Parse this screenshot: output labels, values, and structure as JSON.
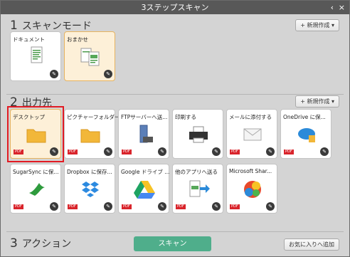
{
  "window": {
    "title": "3ステップスキャン"
  },
  "section1": {
    "num": "1",
    "label": "スキャンモード",
    "new_button": "新規作成"
  },
  "scan_modes": [
    {
      "label": "ドキュメント",
      "icon": "document-scan-icon"
    },
    {
      "label": "おまかせ",
      "icon": "auto-scan-icon",
      "selected": true
    }
  ],
  "section2": {
    "num": "2",
    "label": "出力先",
    "new_button": "新規作成"
  },
  "destinations": [
    {
      "label": "デスクトップ",
      "icon": "folder-icon",
      "pdf": "PDF"
    },
    {
      "label": "ピクチャーフォルダー",
      "icon": "folder-icon",
      "pdf": "PDF"
    },
    {
      "label": "FTPサーバーへ送...",
      "icon": "ftp-server-icon",
      "pdf": "PDF"
    },
    {
      "label": "印刷する",
      "icon": "printer-icon",
      "pdf": ""
    },
    {
      "label": "メールに添付する",
      "icon": "mail-icon",
      "pdf": "PDF"
    },
    {
      "label": "OneDrive に保...",
      "icon": "onedrive-icon",
      "pdf": "PDF"
    },
    {
      "label": "SugarSync に保...",
      "icon": "sugarsync-icon",
      "pdf": "PDF"
    },
    {
      "label": "Dropbox に保存...",
      "icon": "dropbox-icon",
      "pdf": "PDF"
    },
    {
      "label": "Google ドライブ ...",
      "icon": "google-drive-icon",
      "pdf": "PDF"
    },
    {
      "label": "他のアプリへ送る",
      "icon": "send-to-app-icon",
      "pdf": "PDF"
    },
    {
      "label": "Microsoft Shar...",
      "icon": "sharepoint-icon",
      "pdf": "PDF"
    }
  ],
  "section3": {
    "num": "3",
    "label": "アクション"
  },
  "scan_button": "スキャン",
  "favorites_button": "お気に入りへ追加",
  "colors": {
    "accent": "#4fae8b",
    "highlight": "#e21b23",
    "pdf": "#d9242b"
  }
}
